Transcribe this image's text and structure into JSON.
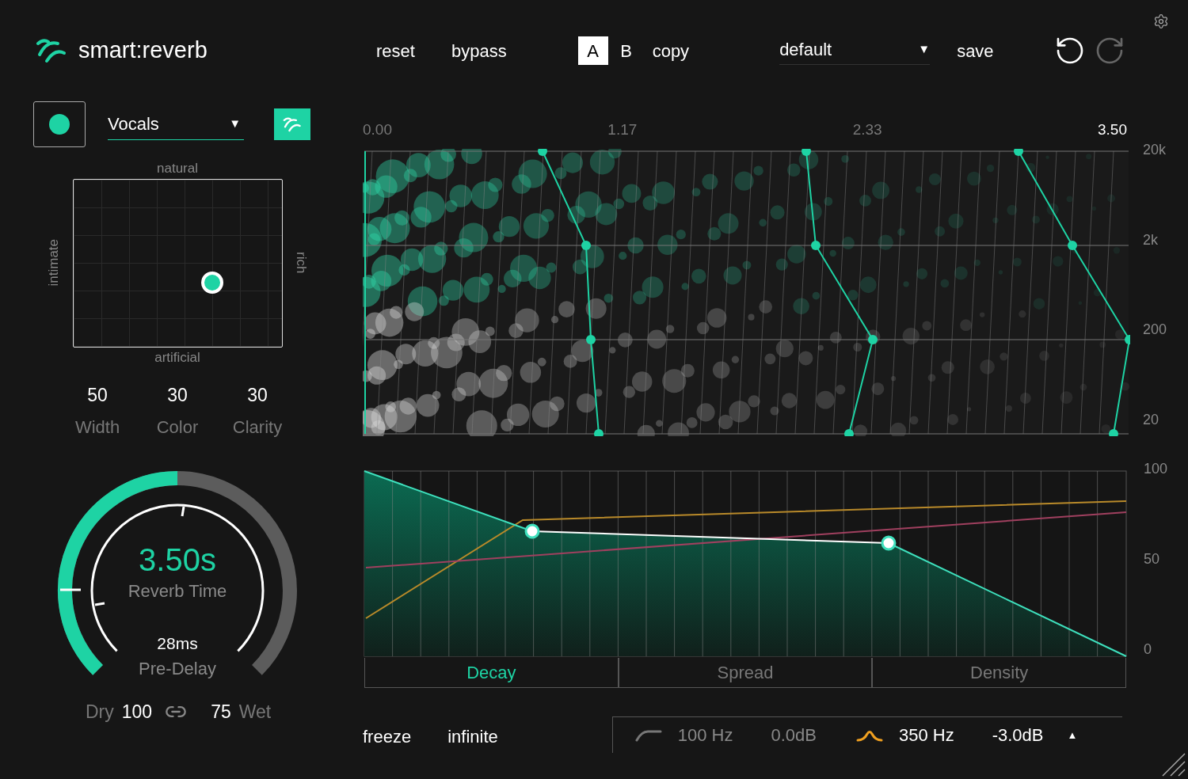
{
  "header": {
    "logo": "smart:reverb",
    "buttons": [
      "reset",
      "bypass"
    ],
    "ab": [
      {
        "label": "A",
        "selected": true
      },
      {
        "label": "B",
        "selected": false
      }
    ],
    "copy": "copy",
    "preset": "default",
    "preset_caret": "▼",
    "save": "save"
  },
  "profile": {
    "active": true,
    "name": "Vocals",
    "caret": "▼"
  },
  "character_pad": {
    "top": "natural",
    "bottom": "artificial",
    "left": "intimate",
    "right": "rich"
  },
  "params": [
    {
      "value": "50",
      "label": "Width"
    },
    {
      "value": "30",
      "label": "Color"
    },
    {
      "value": "30",
      "label": "Clarity"
    }
  ],
  "reverb_time": {
    "level": 0.5,
    "value": "3.50s",
    "label": "Reverb Time",
    "pre_delay": "28ms",
    "pre_delay_label": "Pre-Delay"
  },
  "mix": {
    "dry_label": "Dry",
    "dry": "100",
    "wet": "75",
    "wet_label": "Wet"
  },
  "spectrogram": {
    "x_labels": [
      {
        "text": "0.00",
        "selected": false
      },
      {
        "text": "1.17",
        "selected": false
      },
      {
        "text": "2.33",
        "selected": false
      },
      {
        "text": "3.50",
        "selected": true
      }
    ],
    "y_labels": [
      "20k",
      "2k",
      "200",
      "20"
    ]
  },
  "envelope": {
    "y_labels": [
      "100",
      "50",
      "0"
    ],
    "tabs": [
      {
        "label": "Decay",
        "selected": true
      },
      {
        "label": "Spread",
        "selected": false
      },
      {
        "label": "Density",
        "selected": false
      }
    ]
  },
  "footer": {
    "buttons": [
      "freeze",
      "infinite"
    ],
    "filters": [
      {
        "kind": "lowcut",
        "freq": "100 Hz",
        "gain": "0.0dB",
        "active": false
      },
      {
        "kind": "bell",
        "freq": "350 Hz",
        "gain": "-3.0dB",
        "active": true
      }
    ],
    "toggle": "▲"
  }
}
